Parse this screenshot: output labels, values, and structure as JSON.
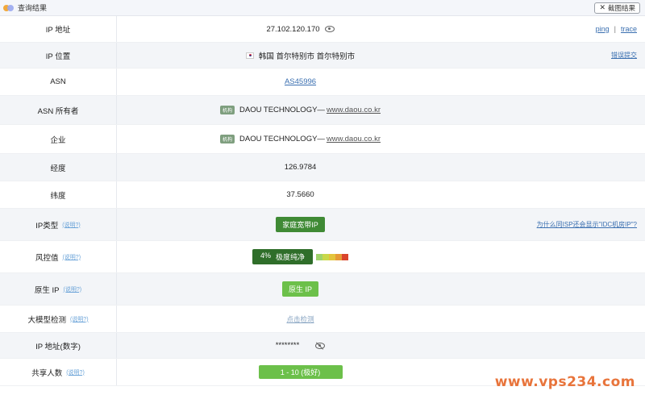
{
  "header": {
    "title": "查询结果",
    "screenshot_label": "截图结果"
  },
  "rows": {
    "ip": {
      "label": "IP 地址",
      "value": "27.102.120.170",
      "ping": "ping",
      "sep": "|",
      "trace": "trace"
    },
    "location": {
      "label": "IP 位置",
      "value": "韩国 首尔特别市 首尔特别市",
      "correction": "错误提交"
    },
    "asn": {
      "label": "ASN",
      "value": "AS45996"
    },
    "asn_owner": {
      "label": "ASN 所有者",
      "tag": "机构",
      "name": "DAOU TECHNOLOGY—",
      "domain": "www.daou.co.kr"
    },
    "enterprise": {
      "label": "企业",
      "tag": "机构",
      "name": "DAOU TECHNOLOGY—",
      "domain": "www.daou.co.kr"
    },
    "longitude": {
      "label": "经度",
      "value": "126.9784"
    },
    "latitude": {
      "label": "纬度",
      "value": "37.5660"
    },
    "ip_type": {
      "label": "IP类型",
      "help": "(说明?)",
      "value": "家庭宽带IP",
      "note": "为什么同ISP还会显示\"IDC机房IP\"?"
    },
    "risk": {
      "label": "风控值",
      "help": "(说明?)",
      "percent": "4%",
      "level": "极度纯净",
      "bar_colors": [
        "#9fd36b",
        "#c9d84a",
        "#e3c43c",
        "#e69a36",
        "#d9442c"
      ]
    },
    "native_ip": {
      "label": "原生 IP",
      "help": "(说明?)",
      "value": "原生 IP"
    },
    "llm_check": {
      "label": "大模型检测",
      "help": "(说明?)",
      "value": "点击检测"
    },
    "ip_numeric": {
      "label": "IP 地址(数字)",
      "value": "********"
    },
    "shared_users": {
      "label": "共享人数",
      "help": "(说明?)",
      "value": "1 - 10 (极好)"
    }
  },
  "watermark": "www.vps234.com"
}
